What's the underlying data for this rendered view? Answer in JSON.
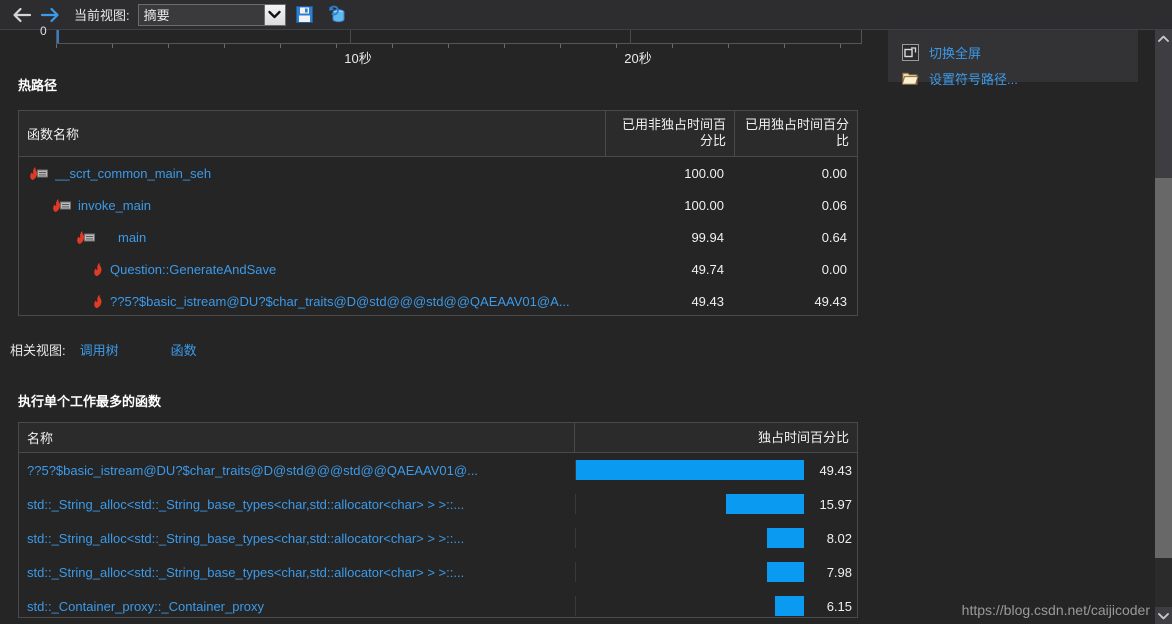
{
  "toolbar": {
    "back_icon": "arrow-left-icon",
    "forward_icon": "arrow-right-icon",
    "current_view_label": "当前视图:",
    "view_value": "摘要",
    "save_icon": "save-disk-icon",
    "database_refresh_icon": "database-refresh-icon"
  },
  "chart": {
    "y_zero_label": "0",
    "x_labels": [
      "10秒",
      "20秒"
    ]
  },
  "hot_path": {
    "title": "热路径",
    "columns": [
      "函数名称",
      "已用非独占时间百分比",
      "已用独占时间百分比"
    ],
    "rows": [
      {
        "name": "__scrt_common_main_seh",
        "inclusive": "100.00",
        "exclusive": "0.00",
        "depth": 0,
        "has_flag": true
      },
      {
        "name": "invoke_main",
        "inclusive": "100.00",
        "exclusive": "0.06",
        "depth": 1,
        "has_flag": true
      },
      {
        "name": "main",
        "inclusive": "99.94",
        "exclusive": "0.64",
        "depth": 2,
        "has_flag": true
      },
      {
        "name": "Question::GenerateAndSave",
        "inclusive": "49.74",
        "exclusive": "0.00",
        "depth": 3,
        "has_flag": false
      },
      {
        "name": "??5?$basic_istream@DU?$char_traits@D@std@@@std@@QAEAAV01@A...",
        "inclusive": "49.43",
        "exclusive": "49.43",
        "depth": 3,
        "has_flag": false
      }
    ]
  },
  "related_views": {
    "label": "相关视图:",
    "links": [
      "调用树",
      "函数"
    ]
  },
  "top_functions": {
    "title": "执行单个工作最多的函数",
    "columns": [
      "名称",
      "独占时间百分比"
    ],
    "rows": [
      {
        "name": "??5?$basic_istream@DU?$char_traits@D@std@@@std@@QAEAAV01@...",
        "value": "49.43"
      },
      {
        "name": "std::_String_alloc<std::_String_base_types<char,std::allocator<char> > >::...",
        "value": "15.97"
      },
      {
        "name": "std::_String_alloc<std::_String_base_types<char,std::allocator<char> > >::...",
        "value": "8.02"
      },
      {
        "name": "std::_String_alloc<std::_String_base_types<char,std::allocator<char> > >::...",
        "value": "7.98"
      },
      {
        "name": "std::_Container_proxy::_Container_proxy",
        "value": "6.15"
      }
    ]
  },
  "side_panel": {
    "items": [
      {
        "label": "切换全屏",
        "icon": "fullscreen-window-icon"
      },
      {
        "label": "设置符号路径...",
        "icon": "folder-open-icon"
      }
    ]
  },
  "scrollbar": {
    "up_icon": "chevron-up-icon",
    "down_icon": "chevron-down-icon"
  },
  "watermark": "https://blog.csdn.net/caijicoder",
  "colors": {
    "accent_link": "#3c9ae8",
    "bar": "#0b9af2",
    "background": "#252526",
    "panel": "#333336"
  },
  "chart_data": {
    "type": "bar",
    "title": "执行单个工作最多的函数",
    "categories": [
      "??5?$basic_istream@DU?$char_traits@D@std@@@std@@QAEAAV01@...",
      "std::_String_alloc<std::_String_base_types<char,std::allocator<char> > >::...",
      "std::_String_alloc<std::_String_base_types<char,std::allocator<char> > >::...",
      "std::_String_alloc<std::_String_base_types<char,std::allocator<char> > >::...",
      "std::_Container_proxy::_Container_proxy"
    ],
    "values": [
      49.43,
      15.97,
      8.02,
      7.98,
      6.15
    ],
    "xlabel": "独占时间百分比",
    "ylabel": "名称",
    "xlim": [
      0,
      49.43
    ],
    "grid": false,
    "legend": "none",
    "orientation": "horizontal"
  }
}
